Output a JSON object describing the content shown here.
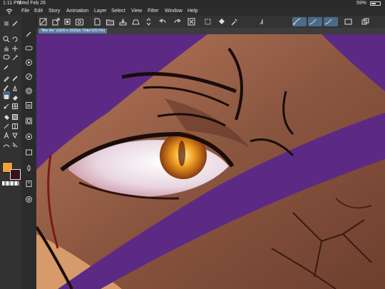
{
  "status": {
    "time": "1:11 PM",
    "date": "Wed Feb 26",
    "battery": "59%"
  },
  "menu": {
    "items": [
      "File",
      "Edit",
      "Story",
      "Animation",
      "Layer",
      "Select",
      "View",
      "Filter",
      "Window",
      "Help"
    ]
  },
  "document": {
    "tab_label": "\"Bite Me\" (1620 x 1620px 72dpi 625.5%)"
  },
  "colors": {
    "main_color": "#f2a238",
    "sub_color": "#3a1212",
    "accent": "#4d6b88"
  },
  "icons": {
    "toolbar": [
      "menu-icon",
      "fit-icon",
      "import-icon",
      "export-icon",
      "new-icon",
      "open-icon",
      "save-icon",
      "print-icon",
      "stepper-icon",
      "undo-icon",
      "redo-icon",
      "clear-icon",
      "fill-icon",
      "eyedrop-icon",
      "stabilizer-1-icon",
      "stabilizer-2-icon",
      "stabilizer-3-icon",
      "transform-icon",
      "layers-icon"
    ],
    "tools": [
      "zoom-icon",
      "move-icon",
      "lasso-icon",
      "magic-wand-icon",
      "eyedropper-icon",
      "pen-icon",
      "pencil-icon",
      "brush-icon",
      "airbrush-icon",
      "eraser-icon",
      "fill-icon",
      "gradient-icon",
      "figure-icon",
      "frame-icon",
      "text-icon",
      "balloon-icon",
      "correct-line-icon",
      "blend-icon"
    ]
  }
}
